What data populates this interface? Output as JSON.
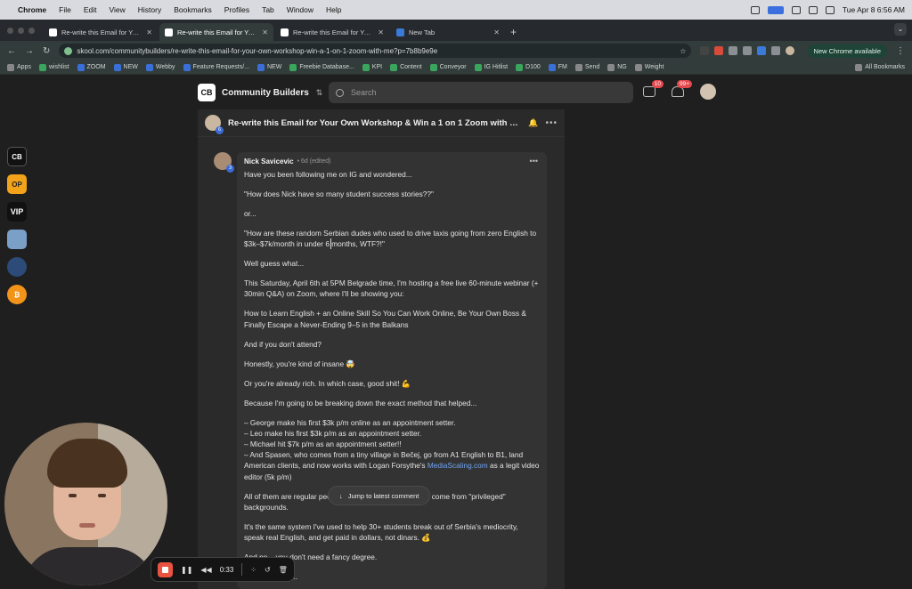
{
  "menubar": {
    "app": "Chrome",
    "items": [
      "File",
      "Edit",
      "View",
      "History",
      "Bookmarks",
      "Profiles",
      "Tab",
      "Window",
      "Help"
    ],
    "clock": "Tue Apr 8  6:56 AM"
  },
  "tabs": [
    {
      "title": "Re-write this Email for Your",
      "active": false
    },
    {
      "title": "Re-write this Email for Your C",
      "active": true
    },
    {
      "title": "Re-write this Email for Your C",
      "active": false
    },
    {
      "title": "New Tab",
      "active": false
    }
  ],
  "address_bar": {
    "url": "skool.com/communitybuilders/re-write-this-email-for-your-own-workshop-win-a-1-on-1-zoom-with-me?p=7b8b9e9e",
    "update_button": "New Chrome available"
  },
  "bookmarks": {
    "items": [
      "Apps",
      "wishlist",
      "ZOOM",
      "NEW",
      "Webby",
      "Feature Requests/...",
      "NEW",
      "Freebie Database...",
      "KPI",
      "Content",
      "Conveyor",
      "IG Hitlist",
      "D100",
      "FM",
      "Send",
      "NG",
      "Weight"
    ],
    "all_label": "All Bookmarks"
  },
  "header": {
    "logo": "CB",
    "community": "Community Builders",
    "search_placeholder": "Search",
    "chat_badge": "10",
    "notif_badge": "99+"
  },
  "dock": [
    "CB",
    "OP",
    "VIP",
    "",
    "",
    "₿"
  ],
  "post": {
    "title": "Re-write this Email for Your Own Workshop & Win a 1 on 1 Zoom with me",
    "author_level": "6"
  },
  "comment": {
    "author": "Nick Savicevic",
    "time": "• 6d (edited)",
    "level": "3",
    "paragraphs": [
      "Have you been following me on IG and wondered...",
      "\"How does Nick have so many student success stories??\"",
      "or...",
      "\"How are these random Serbian dudes who used to drive taxis going from zero English to $3k–$7k/month in under 6 months, WTF?!\"",
      "Well guess what...",
      "This Saturday, April 6th at 5PM Belgrade time, I'm hosting a free live 60-minute webinar (+ 30min Q&A) on Zoom, where I'll be showing you:",
      "How to Learn English + an Online Skill So You Can Work Online, Be Your Own Boss & Finally Escape a Never-Ending 9–5 in the Balkans",
      "And if you don't attend?",
      "Honestly, you're kind of insane 🤯",
      "Or you're already rich. In which case, good shit! 💪",
      "Because I'm going to be breaking down the exact method that helped..."
    ],
    "list": [
      "– George make his first $3k p/m online as an appointment setter.",
      "– Leo make his first $3k p/m as an appointment setter.",
      "– Michael hit $7k p/m as an appointment setter!!"
    ],
    "spasen_before": "– And Spasen, who comes from a tiny village in Bečej, go from A1 English to B1, land American clients, and now works with Logan Forsythe's ",
    "spasen_link": "MediaScaling.com",
    "spasen_after": " as a legit video editor (5k p/m)",
    "after": [
      "All of them are regular people from Serbia! None of them come from \"privileged\" backgrounds.",
      "It's the same system I've used to help 30+ students break out of Serbia's mediocrity, speak real English, and get paid in dollars, not dinars. 💰",
      "And no... you don't need a fancy degree.",
      "Or a perfect gr..."
    ]
  },
  "jump_button": "Jump to latest comment",
  "recorder": {
    "time": "0:33"
  }
}
